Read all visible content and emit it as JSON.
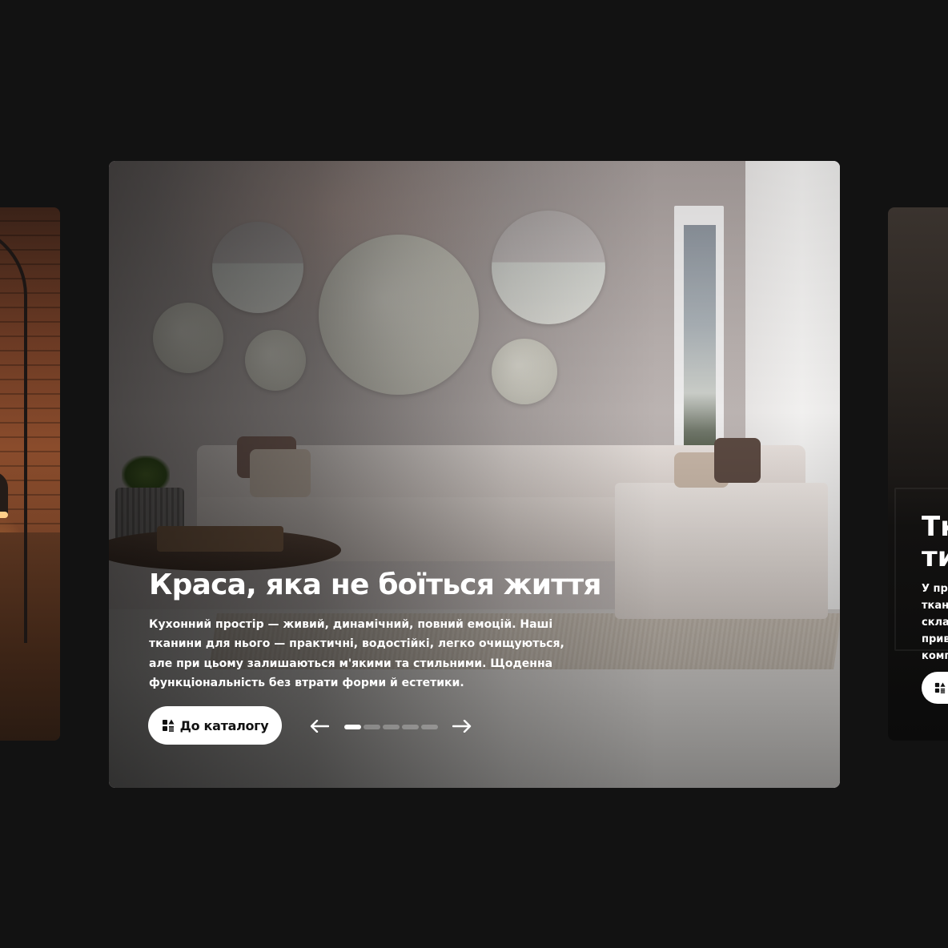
{
  "slides": {
    "current": {
      "title": "Краса, яка не боїться життя",
      "description": "Кухонний простір — живий, динамічний, повний емоцій. Наші тканини для нього — практичні, водостійкі, легко очищуються, але при цьому залишаються м'якими та стильними. Щоденна функціональність без втрати форми й естетики.",
      "button_label": "До каталогу",
      "button_icon": "catalog-icon"
    },
    "next_peek": {
      "title": "Тк\nти",
      "description": "У пре\nткани\nсклад\nприве\nкомп"
    }
  },
  "carousel": {
    "prev_icon": "arrow-left-icon",
    "next_icon": "arrow-right-icon",
    "slide_count": 5,
    "active_index": 0
  },
  "colors": {
    "page_background": "#121212",
    "text": "#ffffff",
    "button_background": "#ffffff",
    "button_text": "#111111"
  }
}
